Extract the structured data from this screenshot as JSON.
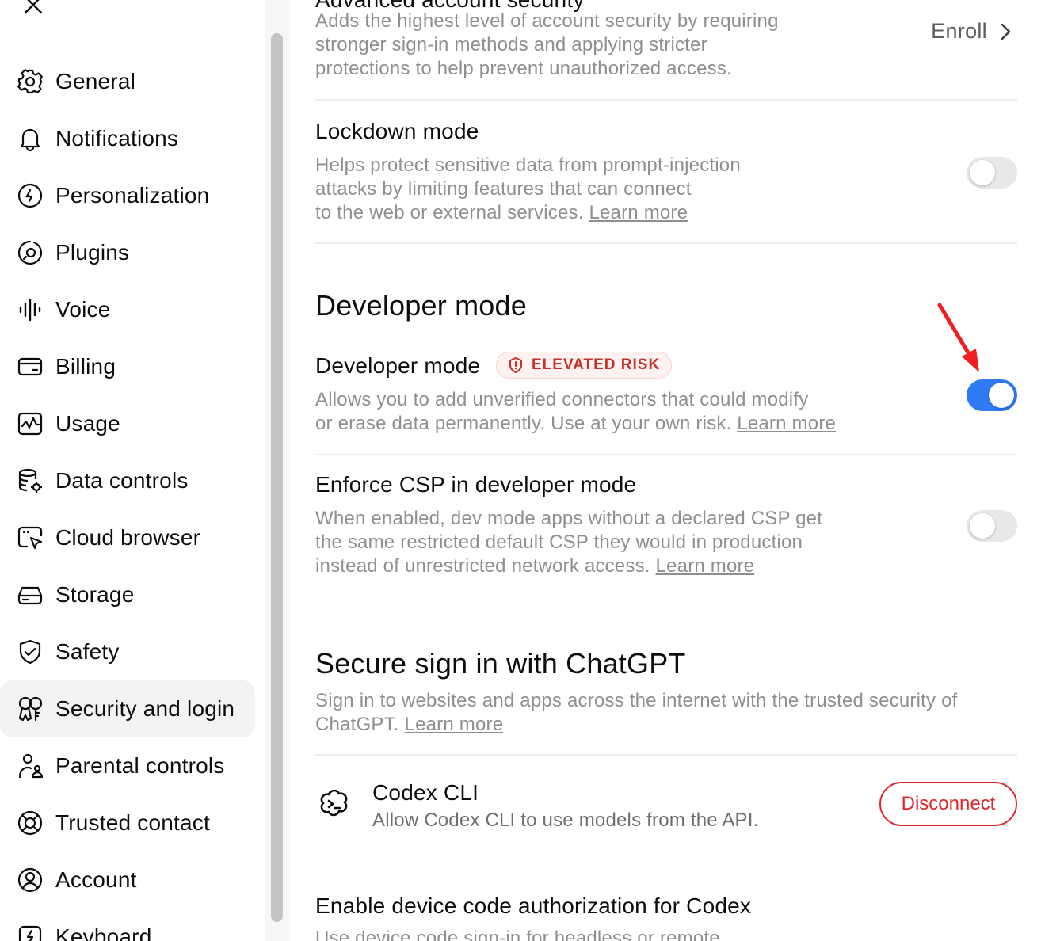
{
  "sidebar": {
    "close_icon": "close-icon",
    "items": [
      {
        "label": "General",
        "icon": "gear-icon"
      },
      {
        "label": "Notifications",
        "icon": "bell-icon"
      },
      {
        "label": "Personalization",
        "icon": "personalization-icon"
      },
      {
        "label": "Plugins",
        "icon": "plugins-icon"
      },
      {
        "label": "Voice",
        "icon": "voice-waveform-icon"
      },
      {
        "label": "Billing",
        "icon": "credit-card-icon"
      },
      {
        "label": "Usage",
        "icon": "usage-chart-icon"
      },
      {
        "label": "Data controls",
        "icon": "database-gear-icon"
      },
      {
        "label": "Cloud browser",
        "icon": "cloud-browser-icon"
      },
      {
        "label": "Storage",
        "icon": "storage-drive-icon"
      },
      {
        "label": "Safety",
        "icon": "shield-check-icon"
      },
      {
        "label": "Security and login",
        "icon": "security-key-icon"
      },
      {
        "label": "Parental controls",
        "icon": "parental-controls-icon"
      },
      {
        "label": "Trusted contact",
        "icon": "lifebuoy-icon"
      },
      {
        "label": "Account",
        "icon": "account-circle-icon"
      },
      {
        "label": "Keyboard",
        "icon": "keyboard-icon"
      }
    ],
    "active_index": 11
  },
  "main": {
    "advanced_security": {
      "title": "Advanced account security",
      "description": "Adds the highest level of account security by requiring stronger sign-in methods and applying stricter protections to help prevent unauthorized access.",
      "description_lines": [
        "Adds the highest level of account security by requiring",
        "stronger sign-in methods and applying stricter",
        "protections to help prevent unauthorized access."
      ],
      "action_label": "Enroll"
    },
    "lockdown": {
      "title": "Lockdown mode",
      "description_lines": [
        "Helps protect sensitive data from prompt-injection",
        "attacks by limiting features that can connect",
        "to the web or external services."
      ],
      "link": "Learn more",
      "enabled": false
    },
    "developer_section": {
      "heading": "Developer mode",
      "developer_mode": {
        "title": "Developer mode",
        "badge": "ELEVATED RISK",
        "description_lines": [
          "Allows you to add unverified connectors that could modify",
          "or erase data permanently. Use at your own risk."
        ],
        "link": "Learn more",
        "enabled": true
      },
      "enforce_csp": {
        "title": "Enforce CSP in developer mode",
        "description_lines": [
          "When enabled, dev mode apps without a declared CSP get",
          "the same restricted default CSP they would in production",
          "instead of unrestricted network access."
        ],
        "link": "Learn more",
        "enabled": false
      }
    },
    "secure_signin": {
      "heading": "Secure sign in with ChatGPT",
      "description_lines": [
        "Sign in to websites and apps across the internet with the trusted security of",
        "ChatGPT."
      ],
      "link": "Learn more",
      "codex_cli": {
        "title": "Codex CLI",
        "description": "Allow Codex CLI to use models from the API.",
        "action_label": "Disconnect",
        "icon": "codex-cli-icon"
      },
      "device_code": {
        "title": "Enable device code authorization for Codex",
        "description": "Use device code sign-in for headless or remote"
      }
    },
    "annotation_arrow": {
      "color": "#f01e1e"
    }
  },
  "colors": {
    "accent_toggle": "#2f7bf6",
    "danger": "#e0262d",
    "badge_text": "#c4302b",
    "muted_text": "#8f8f8f"
  }
}
